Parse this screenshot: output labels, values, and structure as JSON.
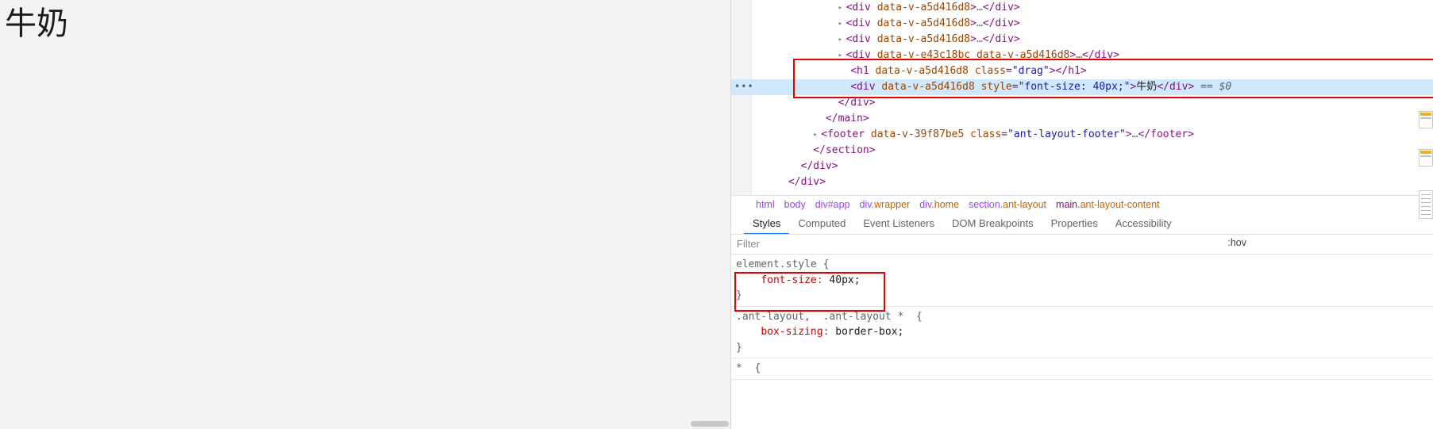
{
  "page": {
    "heading_text": "牛奶"
  },
  "devtools": {
    "elements_tree": [
      {
        "indent": 7,
        "arrow": "▸",
        "tag_open": "<div",
        "attrs": " data-v-a5d416d8",
        "tag_close": ">",
        "ellipsis": "…",
        "close_tag": "</div>",
        "selected": false,
        "partial": true
      },
      {
        "indent": 7,
        "arrow": "▸",
        "tag_open": "<div",
        "attrs": " data-v-a5d416d8",
        "tag_close": ">",
        "ellipsis": "…",
        "close_tag": "</div>",
        "selected": false
      },
      {
        "indent": 7,
        "arrow": "▸",
        "tag_open": "<div",
        "attrs": " data-v-a5d416d8",
        "tag_close": ">",
        "ellipsis": "…",
        "close_tag": "</div>",
        "selected": false
      },
      {
        "indent": 7,
        "arrow": "▸",
        "tag_open": "<div",
        "attrs": " data-v-e43c18bc data-v-a5d416d8",
        "tag_close": ">",
        "ellipsis": "…",
        "close_tag": "</div>",
        "selected": false
      },
      {
        "indent": 8,
        "arrow": "",
        "tag_open": "<h1",
        "attrs": " data-v-a5d416d8 class=\"drag\"",
        "tag_close": ">",
        "ellipsis": "",
        "close_tag": "</h1>",
        "selected": false
      },
      {
        "indent": 8,
        "arrow": "",
        "tag_open": "<div",
        "attrs": " data-v-a5d416d8 style=\"font-size: 40px;\"",
        "tag_close": ">",
        "ellipsis": "",
        "inner_text": "牛奶",
        "close_tag": "</div>",
        "suffix": " == $0",
        "selected": true
      },
      {
        "indent": 7,
        "arrow": "",
        "tag_open": "",
        "attrs": "",
        "tag_close": "",
        "ellipsis": "",
        "close_tag": "</div>",
        "selected": false
      },
      {
        "indent": 6,
        "arrow": "",
        "tag_open": "",
        "attrs": "",
        "tag_close": "",
        "ellipsis": "",
        "close_tag": "</main>",
        "selected": false
      },
      {
        "indent": 5,
        "arrow": "▸",
        "tag_open": "<footer",
        "attrs": " data-v-39f87be5 class=\"ant-layout-footer\"",
        "tag_close": ">",
        "ellipsis": "…",
        "close_tag": "</footer>",
        "selected": false
      },
      {
        "indent": 5,
        "arrow": "",
        "tag_open": "",
        "attrs": "",
        "tag_close": "",
        "ellipsis": "",
        "close_tag": "</section>",
        "selected": false
      },
      {
        "indent": 4,
        "arrow": "",
        "tag_open": "",
        "attrs": "",
        "tag_close": "",
        "ellipsis": "",
        "close_tag": "</div>",
        "selected": false
      },
      {
        "indent": 3,
        "arrow": "",
        "tag_open": "",
        "attrs": "",
        "tag_close": "",
        "ellipsis": "",
        "close_tag": "</div>",
        "selected": false
      }
    ],
    "breadcrumb": [
      {
        "label": "html",
        "type": "tag"
      },
      {
        "label": "body",
        "type": "tag"
      },
      {
        "label": "div#app",
        "type": "id"
      },
      {
        "label": "div",
        "cls": ".wrapper",
        "type": "class"
      },
      {
        "label": "div",
        "cls": ".home",
        "type": "class"
      },
      {
        "label": "section",
        "cls": ".ant-layout",
        "type": "class"
      },
      {
        "label": "main",
        "cls": ".ant-layout-content",
        "type": "class"
      }
    ],
    "panel_tabs": [
      {
        "label": "Styles",
        "active": true
      },
      {
        "label": "Computed",
        "active": false
      },
      {
        "label": "Event Listeners",
        "active": false
      },
      {
        "label": "DOM Breakpoints",
        "active": false
      },
      {
        "label": "Properties",
        "active": false
      },
      {
        "label": "Accessibility",
        "active": false
      }
    ],
    "filter": {
      "placeholder": "Filter",
      "value": "",
      "hov_label": ":hov"
    },
    "style_rules": [
      {
        "selector": "element.style",
        "open": "{",
        "declarations": [
          {
            "name": "font-size",
            "value": "40px"
          }
        ],
        "close": "}",
        "highlighted": true
      },
      {
        "selector": ".ant-layout,  .ant-layout * ",
        "open": "{",
        "declarations": [
          {
            "name": "box-sizing",
            "value": "border-box"
          }
        ],
        "close": "}",
        "highlighted": false
      },
      {
        "selector": "* ",
        "open": "{",
        "declarations": [],
        "close": "",
        "highlighted": false
      }
    ],
    "colors": {
      "selected_row_bg": "#cfe8fc",
      "highlight_border": "#e60000",
      "active_tab_underline": "#1a73e8",
      "tag_color": "#881280",
      "attr_color": "#994500",
      "value_color": "#1a1aa6",
      "prop_name_color": "#c80000"
    }
  }
}
